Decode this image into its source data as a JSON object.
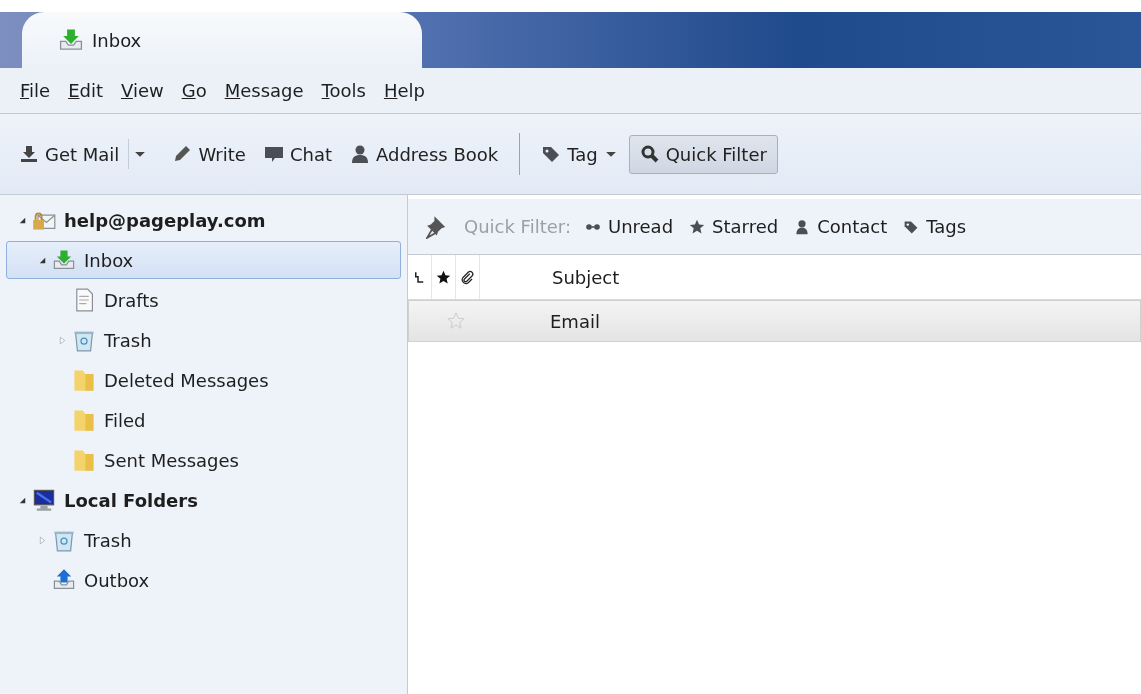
{
  "tabs": [
    {
      "label": "Inbox",
      "kind": "inbox",
      "selected": true
    }
  ],
  "menu": [
    "File",
    "Edit",
    "View",
    "Go",
    "Message",
    "Tools",
    "Help"
  ],
  "toolbar": {
    "groups": [
      [
        {
          "label": "Get Mail",
          "kind": "get-mail",
          "split_dropdown": true,
          "pressed": false
        },
        {
          "label": "Write",
          "kind": "write",
          "pressed": false
        },
        {
          "label": "Chat",
          "kind": "chat",
          "pressed": false
        },
        {
          "label": "Address Book",
          "kind": "address-book",
          "pressed": false
        }
      ],
      [
        {
          "label": "Tag",
          "kind": "tag",
          "dropdown": true,
          "pressed": false
        },
        {
          "label": "Quick Filter",
          "kind": "quick-filter",
          "pressed": true
        }
      ]
    ]
  },
  "sidebar": {
    "items": [
      {
        "label": "help@pageplay.com",
        "kind": "account",
        "expanded": true,
        "selected": false,
        "children": [
          {
            "label": "Inbox",
            "kind": "inbox",
            "expanded": true,
            "selected": true,
            "children": [
              {
                "label": "Drafts",
                "kind": "drafts",
                "selected": false
              },
              {
                "label": "Trash",
                "kind": "trash",
                "expanded": false,
                "selected": false
              },
              {
                "label": "Deleted Messages",
                "kind": "folder",
                "selected": false
              },
              {
                "label": "Filed",
                "kind": "folder",
                "selected": false
              },
              {
                "label": "Sent Messages",
                "kind": "folder",
                "selected": false
              }
            ]
          }
        ]
      },
      {
        "label": "Local Folders",
        "kind": "computer",
        "expanded": true,
        "selected": false,
        "children": [
          {
            "label": "Trash",
            "kind": "trash",
            "expanded": false,
            "selected": false
          },
          {
            "label": "Outbox",
            "kind": "outbox",
            "selected": false
          }
        ]
      }
    ]
  },
  "quick_filter": {
    "sticky": false,
    "label": "Quick Filter:",
    "buttons": [
      {
        "label": "Unread",
        "kind": "unread",
        "selected": false
      },
      {
        "label": "Starred",
        "kind": "starred",
        "selected": false
      },
      {
        "label": "Contact",
        "kind": "contact",
        "selected": false
      },
      {
        "label": "Tags",
        "kind": "tags",
        "selected": false
      }
    ]
  },
  "table": {
    "columns": [
      {
        "kind": "thread"
      },
      {
        "kind": "star"
      },
      {
        "kind": "attachment"
      },
      {
        "kind": "text",
        "label": "Subject"
      }
    ],
    "rows": [
      {
        "starred": false,
        "subject": "Email",
        "selected": true
      }
    ]
  }
}
